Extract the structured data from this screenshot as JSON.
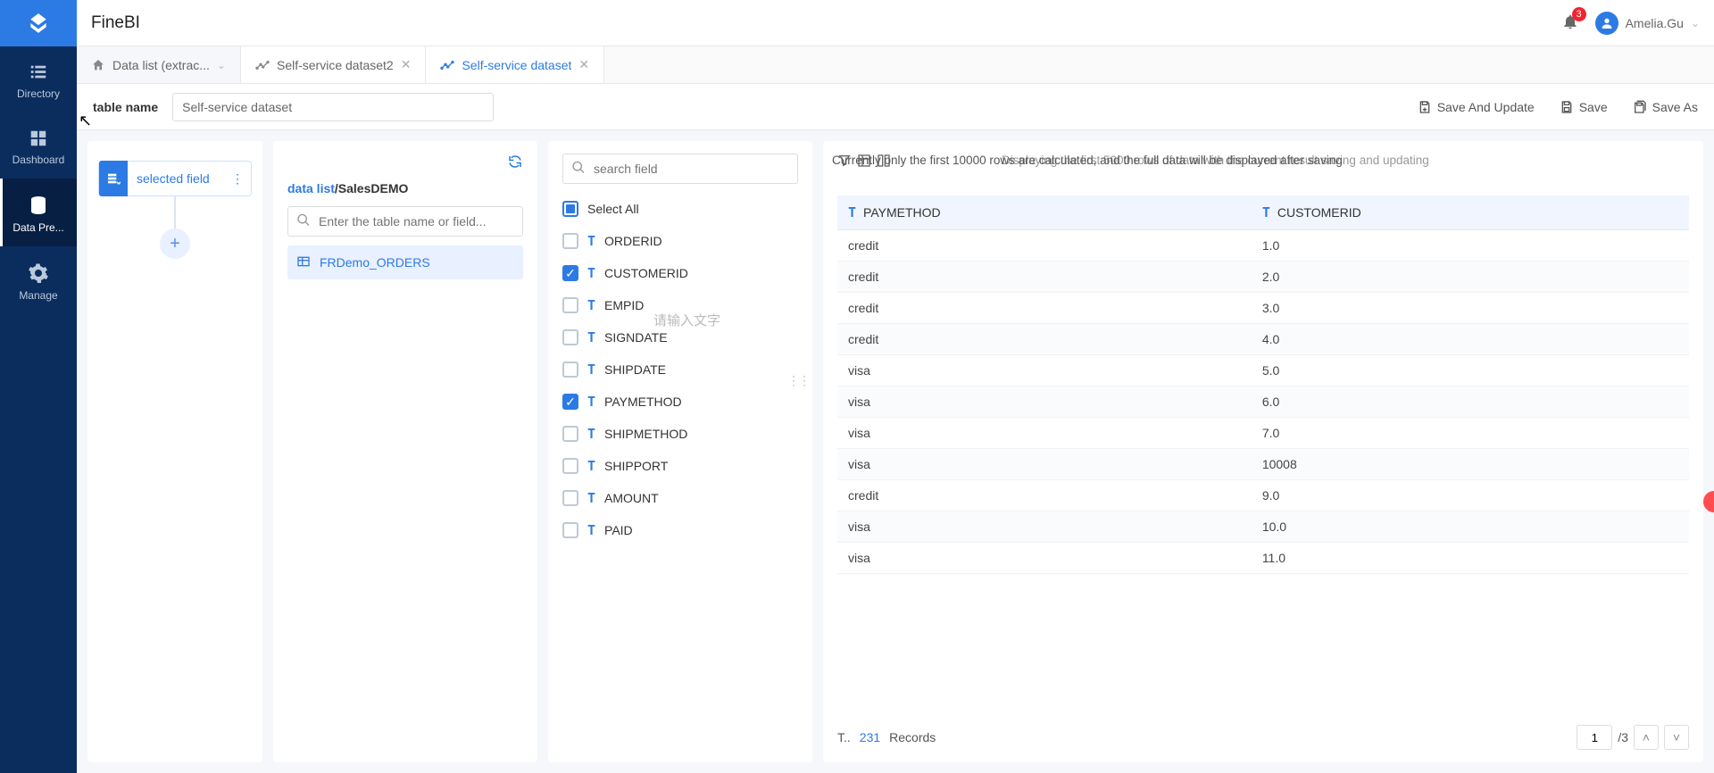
{
  "brand": "FineBI",
  "notifications": {
    "count": "3"
  },
  "user": {
    "name": "Amelia.Gu"
  },
  "sidebar": {
    "items": [
      {
        "label": "Directory"
      },
      {
        "label": "Dashboard"
      },
      {
        "label": "Data Pre..."
      },
      {
        "label": "Manage"
      }
    ]
  },
  "tabs": {
    "home": {
      "label": "Data list (extrac..."
    },
    "items": [
      {
        "label": "Self-service dataset2",
        "active": false
      },
      {
        "label": "Self-service dataset",
        "active": true
      }
    ]
  },
  "toolbar": {
    "table_name_label": "table name",
    "table_name_value": "Self-service dataset",
    "save_update": "Save And Update",
    "save": "Save",
    "save_as": "Save As"
  },
  "flow": {
    "step_label": "selected field",
    "add_label": "+"
  },
  "datalist": {
    "crumb_prefix": "data list",
    "crumb_sep": "/",
    "crumb_current": "SalesDEMO",
    "search_placeholder": "Enter the table name or field...",
    "tables": [
      {
        "name": "FRDemo_ORDERS"
      }
    ]
  },
  "fields": {
    "search_placeholder": "search field",
    "select_all": "Select All",
    "ghost_placeholder": "请输入文字",
    "items": [
      {
        "name": "ORDERID",
        "checked": false
      },
      {
        "name": "CUSTOMERID",
        "checked": true
      },
      {
        "name": "EMPID",
        "checked": false
      },
      {
        "name": "SIGNDATE",
        "checked": false
      },
      {
        "name": "SHIPDATE",
        "checked": false
      },
      {
        "name": "PAYMETHOD",
        "checked": true
      },
      {
        "name": "SHIPMETHOD",
        "checked": false
      },
      {
        "name": "SHIPPORT",
        "checked": false
      },
      {
        "name": "AMOUNT",
        "checked": false
      },
      {
        "name": "PAID",
        "checked": false
      }
    ]
  },
  "preview": {
    "info1": "Currently only the first 10000 rows are calculated, and the full data will be displayed after saving",
    "info2": "Displaying the first 5000 rows of data with the current result saving and updating",
    "columns": [
      {
        "name": "PAYMETHOD"
      },
      {
        "name": "CUSTOMERID"
      }
    ],
    "rows": [
      {
        "c0": "credit",
        "c1": "1.0"
      },
      {
        "c0": "credit",
        "c1": "2.0"
      },
      {
        "c0": "credit",
        "c1": "3.0"
      },
      {
        "c0": "credit",
        "c1": "4.0"
      },
      {
        "c0": "visa",
        "c1": "5.0"
      },
      {
        "c0": "visa",
        "c1": "6.0"
      },
      {
        "c0": "visa",
        "c1": "7.0"
      },
      {
        "c0": "visa",
        "c1": "10008"
      },
      {
        "c0": "credit",
        "c1": "9.0"
      },
      {
        "c0": "visa",
        "c1": "10.0"
      },
      {
        "c0": "visa",
        "c1": "11.0"
      }
    ],
    "pager": {
      "total_label_abbr": "T..",
      "total_count": "231",
      "records_label": "Records",
      "page": "1",
      "pages": "/3"
    }
  }
}
